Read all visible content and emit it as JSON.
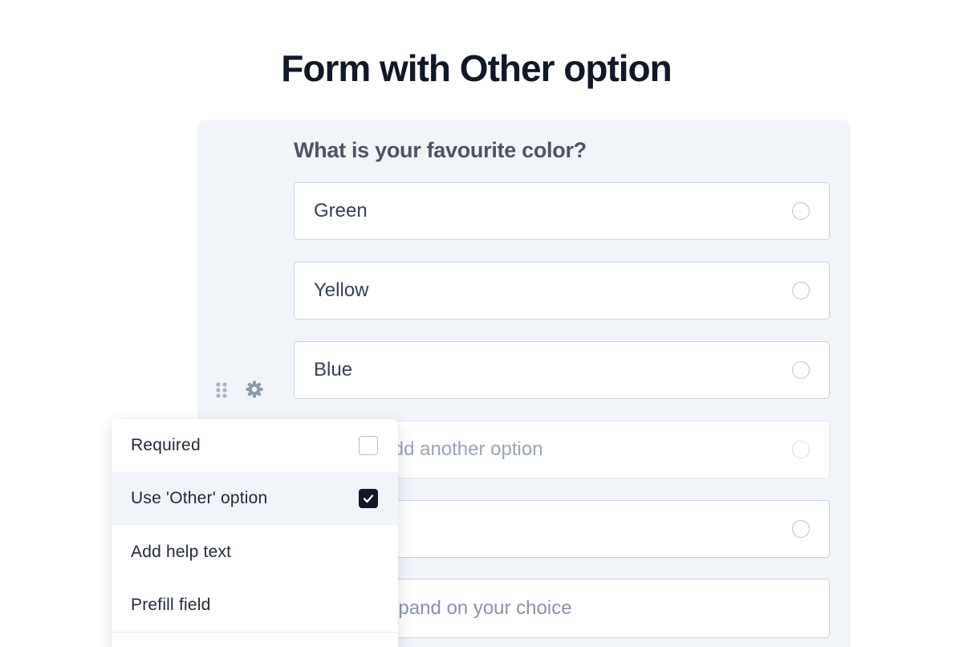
{
  "page": {
    "title": "Form with Other option"
  },
  "question": {
    "label": "What is your favourite color?",
    "options": [
      {
        "label": "Green",
        "selected": false
      },
      {
        "label": "Yellow",
        "selected": false
      },
      {
        "label": "Blue",
        "selected": false
      }
    ],
    "add_option_placeholder": "Type to add another option",
    "other_option_label": "",
    "other_input_placeholder": "Please expand on your choice"
  },
  "field_toolbar": {
    "drag_icon": "drag-handle-icon",
    "settings_icon": "gear-icon"
  },
  "settings_menu": {
    "items": [
      {
        "label": "Required",
        "checked": false
      },
      {
        "label": "Use 'Other' option",
        "checked": true,
        "highlighted": true
      },
      {
        "label": "Add help text"
      },
      {
        "label": "Prefill field"
      }
    ]
  },
  "colors": {
    "card_background": "#f1f5fa",
    "accent": "#111827",
    "muted_text": "#9aa4b4"
  }
}
